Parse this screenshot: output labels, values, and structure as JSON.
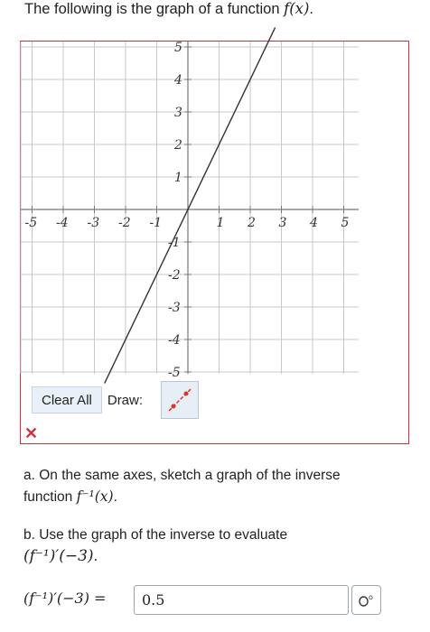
{
  "question": {
    "intro": "The following is the graph of a function ",
    "function_label": "f(x)",
    "period": "."
  },
  "graph": {
    "x_ticks": [
      "-5",
      "-4",
      "-3",
      "-2",
      "-1",
      "1",
      "2",
      "3",
      "4",
      "5"
    ],
    "y_ticks_pos": [
      "1",
      "2",
      "3",
      "4",
      "5"
    ],
    "y_ticks_neg": [
      "-1",
      "-2",
      "-3",
      "-4",
      "-5"
    ],
    "xlim": [
      -5,
      5
    ],
    "ylim": [
      -5,
      5
    ],
    "line": {
      "slope": 2,
      "intercept": 0,
      "color": "#333333"
    },
    "grid_color": "#c8c8c8",
    "axis_color": "#777777"
  },
  "toolbar": {
    "clear_label": "Clear All",
    "draw_label": "Draw:",
    "tool_icon": "line-segment-tool-icon",
    "tool_color": "#d9362b"
  },
  "status": {
    "incorrect_mark": "✕"
  },
  "part_a": {
    "text_1": "a. On the same axes, sketch a graph of the inverse",
    "text_2": "function ",
    "expr": "f⁻¹(x)",
    "end": "."
  },
  "part_b": {
    "text": "b. Use the graph of the inverse to evaluate",
    "expr": "(f⁻¹)′(−3)",
    "end": "."
  },
  "answer": {
    "lhs": "(f⁻¹)′(−3) =",
    "value": "0.5",
    "keypad_icon": "math-keypad-icon"
  }
}
